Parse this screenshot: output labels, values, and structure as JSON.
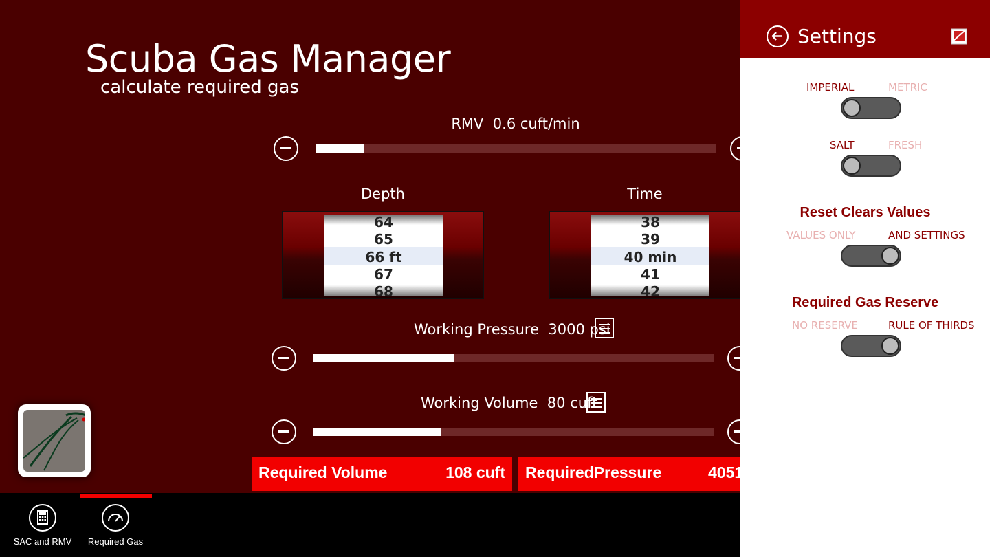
{
  "main": {
    "title": "Scuba Gas Manager",
    "subtitle": "calculate required gas",
    "rmv": {
      "label": "RMV",
      "value": "0.6 cuft/min",
      "fraction": 0.12
    },
    "depth": {
      "label": "Depth",
      "items": [
        "64",
        "65",
        "66 ft",
        "67",
        "68"
      ],
      "selected": "66 ft"
    },
    "time": {
      "label": "Time",
      "items": [
        "38",
        "39",
        "40 min",
        "41",
        "42"
      ],
      "selected": "40 min"
    },
    "working_pressure": {
      "label": "Working Pressure",
      "value": "3000 psi",
      "fraction": 0.35
    },
    "working_volume": {
      "label": "Working Volume",
      "value": "80 cuft",
      "fraction": 0.32
    },
    "results": {
      "volume_label": "Required Volume",
      "volume_value": "108 cuft",
      "pressure_label": "RequiredPressure",
      "pressure_value": "4051"
    }
  },
  "appbar": {
    "items": [
      {
        "label": "SAC and RMV",
        "icon": "calculator-icon",
        "selected": false
      },
      {
        "label": "Required Gas",
        "icon": "gauge-icon",
        "selected": true
      }
    ]
  },
  "settings": {
    "title": "Settings",
    "units": {
      "left": "IMPERIAL",
      "right": "METRIC",
      "state": "left"
    },
    "water": {
      "left": "SALT",
      "right": "FRESH",
      "state": "left"
    },
    "reset": {
      "heading": "Reset Clears Values",
      "left": "VALUES ONLY",
      "right": "AND SETTINGS",
      "state": "right"
    },
    "reserve": {
      "heading": "Required Gas Reserve",
      "left": "NO RESERVE",
      "right": "RULE OF THIRDS",
      "state": "right"
    }
  },
  "colors": {
    "background": "#4a0000",
    "accent": "#f20000",
    "settings_header": "#8c0000"
  }
}
